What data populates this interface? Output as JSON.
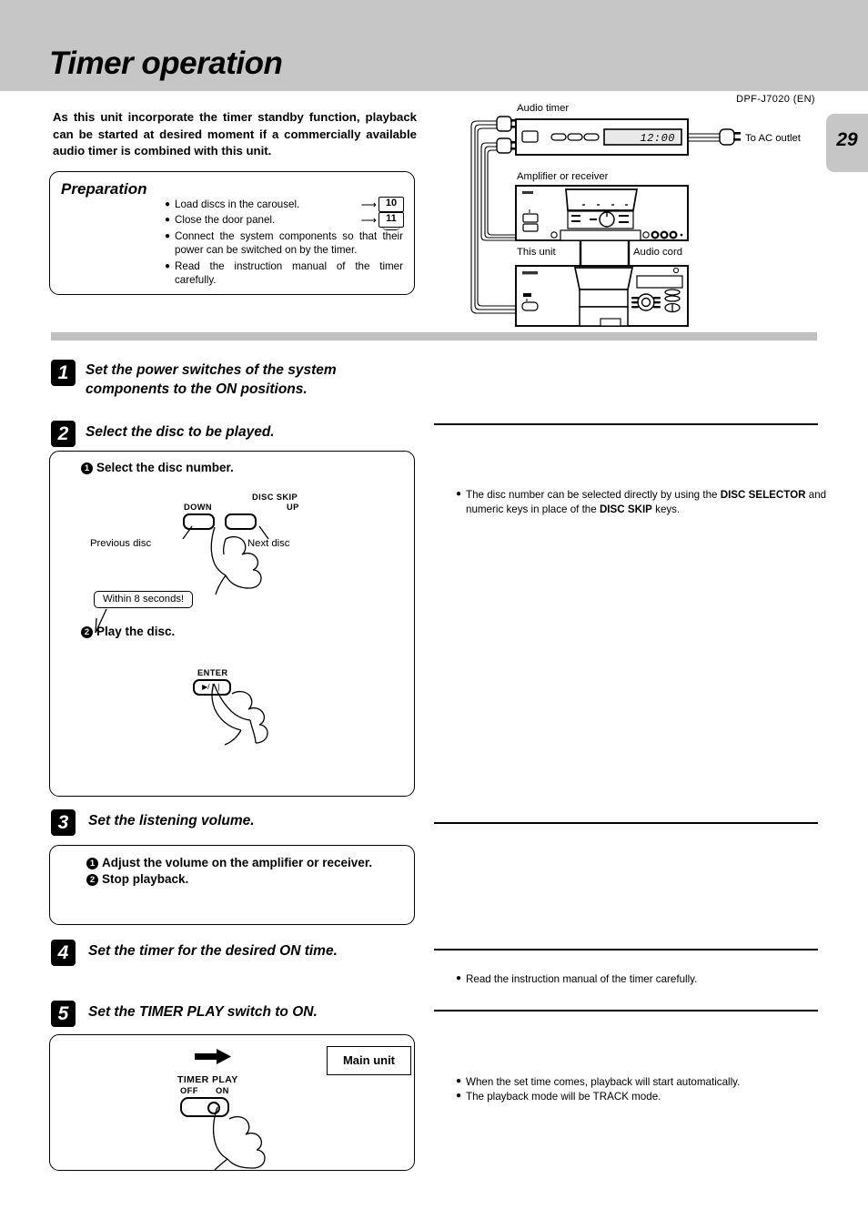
{
  "header": {
    "title": "Timer operation",
    "page_number": "29",
    "model_code": "DPF-J7020 (EN)"
  },
  "intro": "As this unit incorporate the timer standby function, playback can be started at desired moment if a commercially available audio timer is combined with this unit.",
  "preparation": {
    "title": "Preparation",
    "items": [
      {
        "text": "Load discs in the carousel.",
        "ref": "10"
      },
      {
        "text": "Close the door panel.",
        "ref": "11"
      },
      {
        "text": "Connect the system components so that their power can be switched on by the timer.",
        "ref": ""
      },
      {
        "text": "Read the instruction manual of the timer carefully.",
        "ref": ""
      }
    ]
  },
  "diagram": {
    "labels": {
      "audio_timer": "Audio timer",
      "amplifier": "Amplifier or receiver",
      "this_unit": "This unit",
      "audio_cord": "Audio cord",
      "ac_outlet": "To AC outlet"
    },
    "timer_display": "12:00"
  },
  "steps": [
    {
      "number": "1",
      "title": "Set the power switches of the system components to the ON positions."
    },
    {
      "number": "2",
      "title": "Select the disc to be played.",
      "panel": {
        "sub1_num": "1",
        "sub1": "Select the disc number.",
        "sub2_num": "2",
        "sub2": "Play the disc.",
        "disc_skip_label": "DISC SKIP",
        "down_label": "DOWN",
        "up_label": "UP",
        "previous_disc": "Previous disc",
        "next_disc": "Next disc",
        "balloon": "Within 8 seconds!",
        "enter_label": "ENTER",
        "enter_glyph": "▶/❘❘"
      },
      "note": {
        "prefix": "The disc number can be selected directly by using the ",
        "bold1": "DISC SELECTOR",
        "middle": " and numeric keys in place of the ",
        "bold2": "DISC SKIP",
        "suffix": " keys."
      }
    },
    {
      "number": "3",
      "title": "Set the listening volume.",
      "panel": {
        "sub1_num": "1",
        "sub1": "Adjust the volume on the amplifier or receiver.",
        "sub2_num": "2",
        "sub2": "Stop playback."
      }
    },
    {
      "number": "4",
      "title": "Set the timer for the desired ON time.",
      "note": "Read the instruction manual of the timer carefully."
    },
    {
      "number": "5",
      "title": "Set the TIMER PLAY switch to ON.",
      "panel": {
        "main_unit": "Main unit",
        "switch_label": "TIMER PLAY",
        "off_label": "OFF",
        "on_label": "ON"
      },
      "notes": [
        "When the set time comes, playback will start automatically.",
        "The playback mode will be TRACK mode."
      ]
    }
  ],
  "colors": {
    "header_gray": "#c6c6c6",
    "divider_gray": "#c0c0c0"
  }
}
